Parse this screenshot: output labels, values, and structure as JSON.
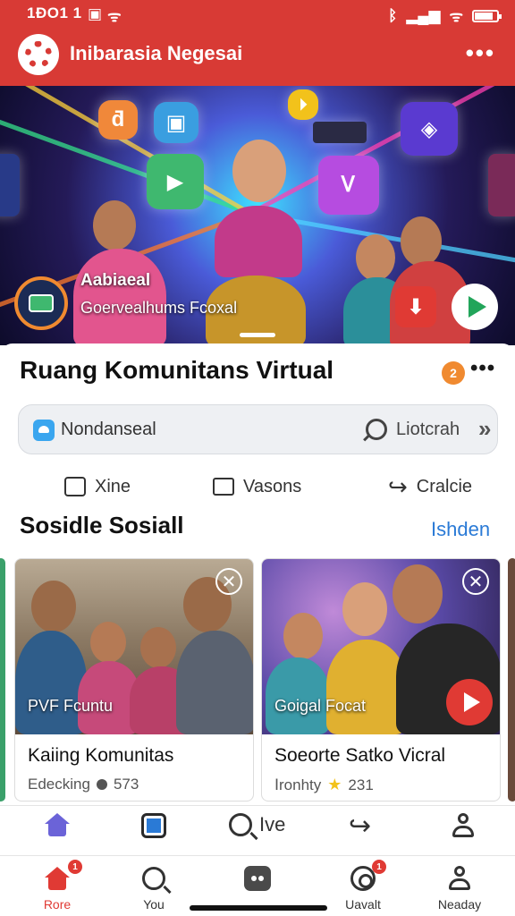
{
  "status_bar": {
    "time": "1ƉO1 1",
    "battery_level": 0.85
  },
  "app_bar": {
    "title": "Inibarasia Negesai",
    "more_label": "•••"
  },
  "hero": {
    "title": "Aabiaeal",
    "subtitle": "Goervealhums Fcoxal",
    "tile_labels": [
      "ƌ",
      "▣",
      "▶",
      "⏵",
      "Ꮩ",
      "◈"
    ]
  },
  "page": {
    "title": "Ruang Komunitans Virtual",
    "badge": "2",
    "more_label": "•••"
  },
  "search": {
    "value": "Nondanseal",
    "placeholder": "Liotcrah",
    "chevron": "»"
  },
  "actions": [
    {
      "label": "Xine",
      "icon": "media-icon"
    },
    {
      "label": "Vasons",
      "icon": "chat-bubble-icon"
    },
    {
      "label": "Cralcie",
      "icon": "share-icon"
    }
  ],
  "section": {
    "title": "Sosidle Sosiall",
    "link": "Ishden"
  },
  "cards": [
    {
      "image_label": "PVF Fcuntu",
      "title": "Kaiing Komunitas",
      "meta_text": "Edecking",
      "meta_count": "573",
      "meta_icon": "dot-icon"
    },
    {
      "image_label": "Goigal Focat",
      "title": "Soeorte Satko Vicral",
      "meta_text": "Ⅰronhty",
      "meta_count": "231",
      "meta_icon": "star-icon"
    }
  ],
  "toolbar": {
    "search_label": "Ive"
  },
  "bottom_nav": [
    {
      "label": "Rore",
      "icon": "home-icon",
      "badge": "1",
      "active": true
    },
    {
      "label": "You",
      "icon": "search-icon"
    },
    {
      "label": "",
      "icon": "chat-icon"
    },
    {
      "label": "Uavalt",
      "icon": "target-icon",
      "badge": "1"
    },
    {
      "label": "Neaday",
      "icon": "profile-icon"
    }
  ],
  "colors": {
    "brand": "#d83a35",
    "link": "#2a7ad6",
    "accent": "#f08a30"
  }
}
